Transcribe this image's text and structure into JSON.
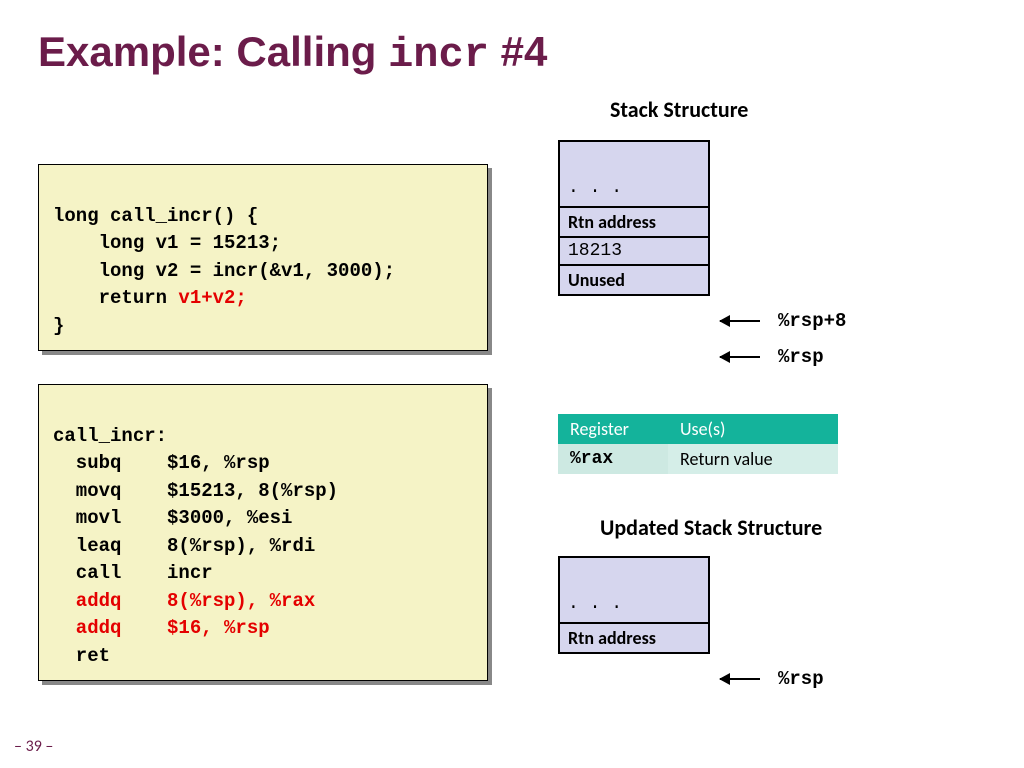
{
  "title_pre": "Example: Calling ",
  "title_code": "incr",
  "title_post": " #4",
  "c_code": {
    "l1": "long call_incr() {",
    "l2": "    long v1 = 15213;",
    "l3": "    long v2 = incr(&v1, 3000);",
    "l4": "    return ",
    "l4_hl": "v1+v2;",
    "l5": "}"
  },
  "asm": {
    "l1": "call_incr:",
    "l2": "  subq    $16, %rsp",
    "l3": "  movq    $15213, 8(%rsp)",
    "l4": "  movl    $3000, %esi",
    "l5": "  leaq    8(%rsp), %rdi",
    "l6": "  call    incr",
    "l7": "  addq    8(%rsp), %rax",
    "l8": "  addq    $16, %rsp",
    "l9": "  ret"
  },
  "stack1_heading": "Stack Structure",
  "stack1": {
    "dots": ". . .",
    "rtn": "Rtn address",
    "v": "18213",
    "unused": "Unused"
  },
  "ptr1": "%rsp+8",
  "ptr2": "%rsp",
  "reg_table": {
    "h1": "Register",
    "h2": "Use(s)",
    "r1c1": "%rax",
    "r1c2": "Return value"
  },
  "stack2_heading": "Updated Stack Structure",
  "stack2": {
    "dots": ". . .",
    "rtn": "Rtn address"
  },
  "ptr3": "%rsp",
  "page": "– 39 –"
}
